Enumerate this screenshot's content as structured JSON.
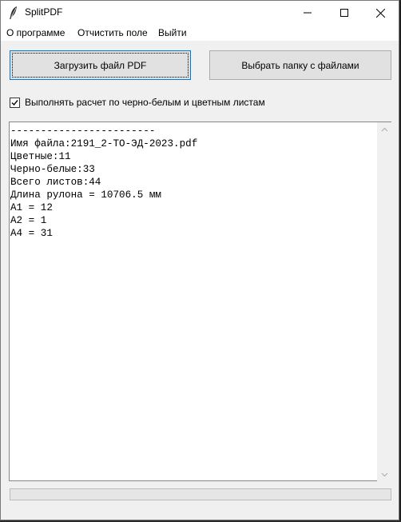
{
  "window": {
    "title": "SplitPDF",
    "controls": {
      "minimize": "minimize",
      "maximize": "maximize",
      "close": "close"
    }
  },
  "menu": {
    "items": [
      "О программе",
      "Отчистить поле",
      "Выйти"
    ]
  },
  "buttons": {
    "load_pdf": "Загрузить файл PDF",
    "choose_folder": "Выбрать папку с файлами"
  },
  "option": {
    "label": "Выполнять расчет по черно-белым и цветным листам",
    "checked": true
  },
  "output": {
    "lines": [
      "------------------------",
      "Имя файла:2191_2-ТО-ЭД-2023.pdf",
      "Цветные:11",
      "Черно-белые:33",
      "Всего листов:44",
      "Длина рулона = 10706.5 мм",
      "А1 = 12",
      "А2 = 1",
      "А4 = 31"
    ]
  },
  "progress": {
    "value": 0
  },
  "colors": {
    "accent": "#0078d7",
    "button_bg": "#e1e1e1",
    "window_bg": "#f0f0f0"
  },
  "icons": {
    "app": "feather-icon",
    "scroll_up": "chevron-up-icon",
    "scroll_down": "chevron-down-icon"
  }
}
